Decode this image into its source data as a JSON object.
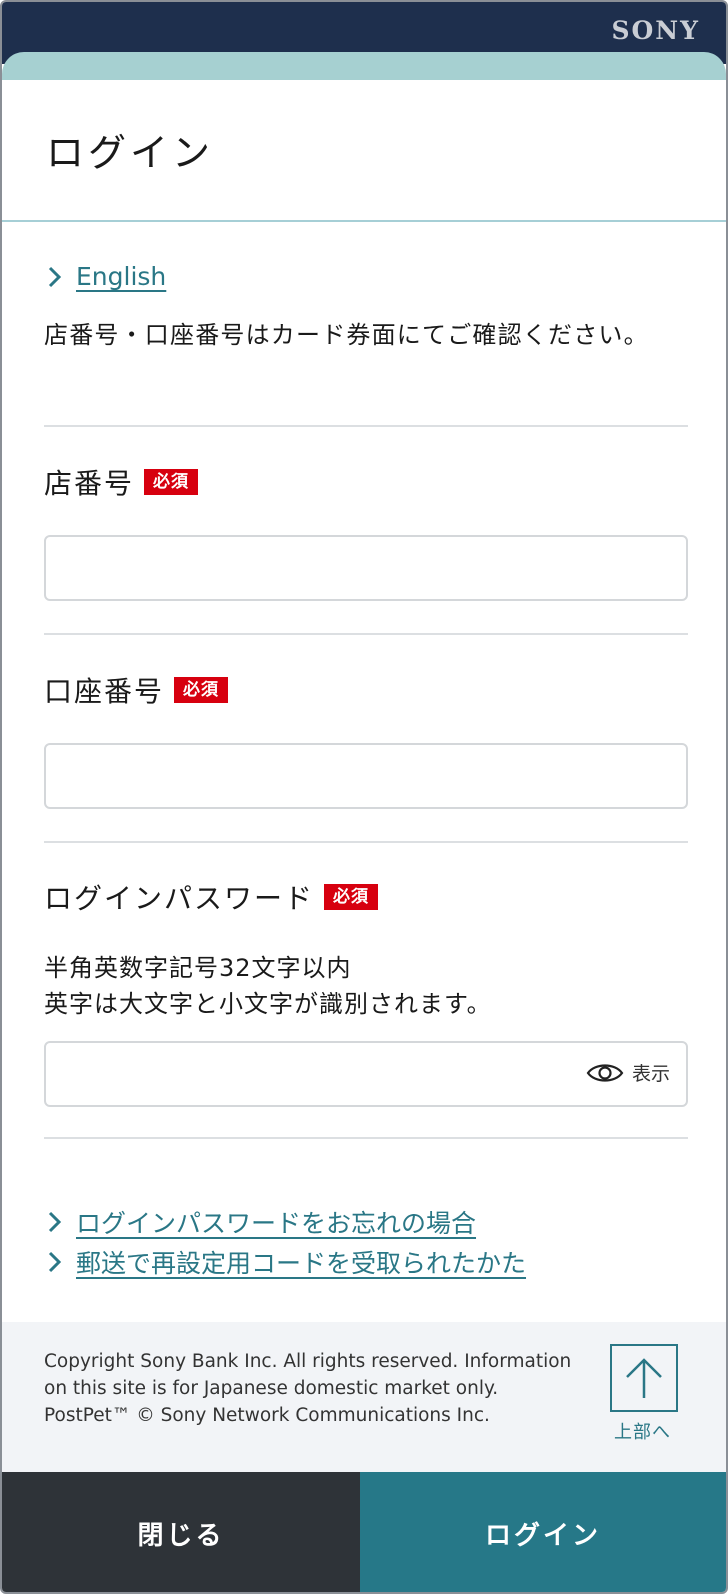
{
  "brand": {
    "name": "SONY"
  },
  "header": {
    "title": "ログイン"
  },
  "language_link": "English",
  "intro_text": "店番号・口座番号はカード券面にてご確認ください。",
  "fields": {
    "branch": {
      "label": "店番号",
      "required": "必須",
      "value": "",
      "placeholder": ""
    },
    "account": {
      "label": "口座番号",
      "required": "必須",
      "value": "",
      "placeholder": ""
    },
    "password": {
      "label": "ログインパスワード",
      "required": "必須",
      "note_line1": "半角英数字記号32文字以内",
      "note_line2": "英字は大文字と小文字が識別されます。",
      "value": "",
      "placeholder": "",
      "toggle_label": "表示"
    }
  },
  "help_links": [
    {
      "label": "ログインパスワードをお忘れの場合"
    },
    {
      "label": "郵送で再設定用コードを受取られたかた"
    }
  ],
  "footer": {
    "copyright": "Copyright Sony Bank Inc. All rights reserved. Information on this site is for Japanese domestic market only.",
    "postpet": "PostPet™ © Sony Network Communications Inc.",
    "to_top_label": "上部へ"
  },
  "actions": {
    "close_label": "閉じる",
    "login_label": "ログイン"
  },
  "colors": {
    "topbar": "#1e2f4d",
    "accent_teal": "#267888",
    "link": "#2a7786",
    "required_badge": "#d7000f",
    "close_button": "#2e3338"
  },
  "icons": {
    "link_chevron": "chevron-right-icon",
    "password_toggle": "eye-icon",
    "to_top": "arrow-up-icon"
  }
}
